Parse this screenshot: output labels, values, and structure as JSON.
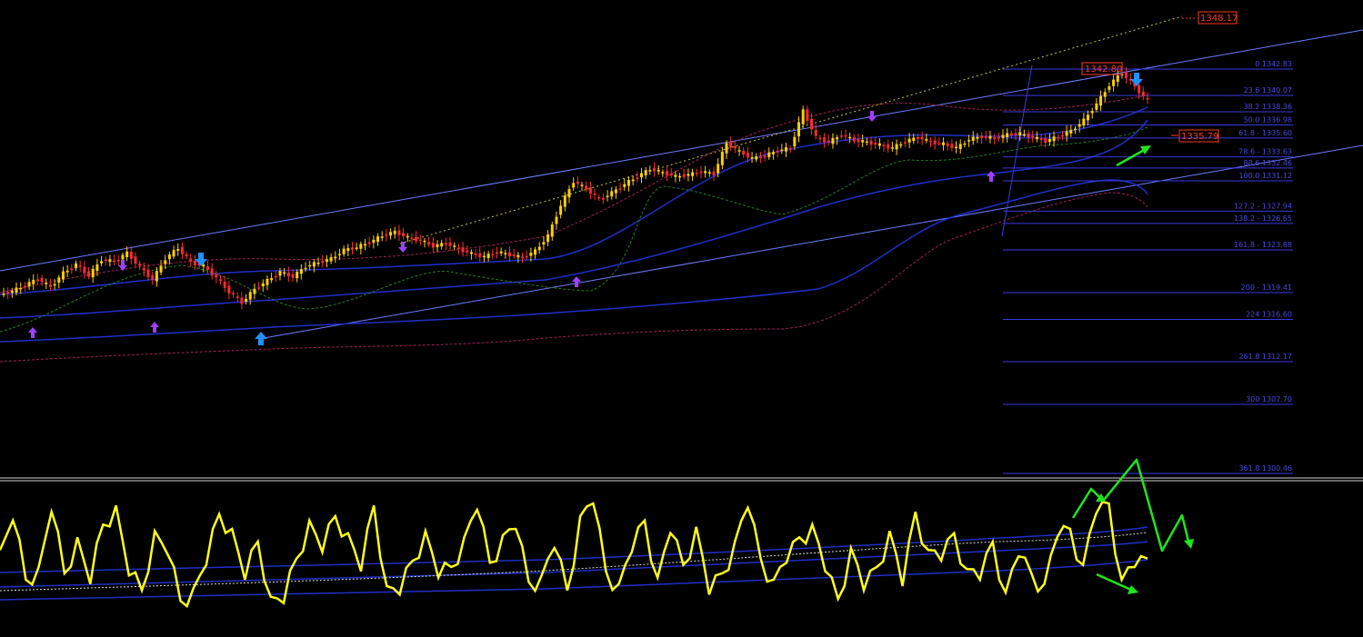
{
  "colors": {
    "background": "#000000",
    "bull_candle": "#ffd000",
    "bear_candle": "#ff2a2a",
    "channel": "#6f7dff",
    "ma_blue": "#1f2fc8",
    "band_magenta": "#a0205a",
    "band_green": "#2c7a2c",
    "fib_line": "#3a3ae0",
    "fib_text": "#4a4ae0",
    "oscillator": "#ffff1a",
    "annotation_arrow": "#1ee61e",
    "price_tag": "#ff3a1a",
    "arrow_signal": "#a040ff",
    "arrow_signal_alt": "#2090ff"
  },
  "price_tags": [
    {
      "value": "1348.17"
    },
    {
      "value": "1342.80"
    },
    {
      "value": "1335.79"
    }
  ],
  "chart_data": [
    {
      "type": "candlestick",
      "fib_levels": [
        {
          "label": "0 1342.83",
          "price": 1342.83
        },
        {
          "label": "23.6 1340.07",
          "price": 1340.07
        },
        {
          "label": "38.2 1338.36",
          "price": 1338.36
        },
        {
          "label": "50.0 1336.98",
          "price": 1336.98
        },
        {
          "label": "61.8 - 1335.60",
          "price": 1335.6
        },
        {
          "label": "78.6 - 1333.63",
          "price": 1333.63
        },
        {
          "label": "88.6 1332.46",
          "price": 1332.46
        },
        {
          "label": "100.0 1331.12",
          "price": 1331.12
        },
        {
          "label": "127.2 - 1327.94",
          "price": 1327.94
        },
        {
          "label": "138.2 - 1326.65",
          "price": 1326.65
        },
        {
          "label": "161.8 - 1323.88",
          "price": 1323.88
        },
        {
          "label": "200 - 1319.41",
          "price": 1319.41
        },
        {
          "label": "224 1316.60",
          "price": 1316.6
        },
        {
          "label": "261.8 1312.17",
          "price": 1312.17
        },
        {
          "label": "300 1307.70",
          "price": 1307.7
        },
        {
          "label": "361.8 1300.46",
          "price": 1300.46
        }
      ],
      "close_series": [
        1319.0,
        1319.6,
        1320.3,
        1319.4,
        1320.9,
        1321.8,
        1320.6,
        1322.3,
        1322.1,
        1323.0,
        1321.5,
        1320.2,
        1322.4,
        1323.5,
        1322.0,
        1321.6,
        1320.4,
        1318.9,
        1317.8,
        1319.2,
        1320.1,
        1321.0,
        1320.5,
        1321.6,
        1322.0,
        1322.4,
        1323.3,
        1323.6,
        1324.1,
        1324.8,
        1325.2,
        1324.6,
        1324.3,
        1323.7,
        1324.0,
        1323.4,
        1322.9,
        1322.6,
        1323.1,
        1322.8,
        1322.5,
        1323.2,
        1324.8,
        1328.0,
        1330.5,
        1329.7,
        1328.6,
        1329.3,
        1330.2,
        1331.0,
        1331.8,
        1331.4,
        1331.0,
        1331.2,
        1331.5,
        1331.3,
        1334.5,
        1333.6,
        1332.9,
        1333.2,
        1333.7,
        1334.0,
        1337.9,
        1335.1,
        1334.6,
        1335.4,
        1334.8,
        1334.6,
        1334.3,
        1334.0,
        1334.7,
        1335.1,
        1334.6,
        1334.4,
        1334.0,
        1334.9,
        1335.2,
        1335.0,
        1335.4,
        1335.5,
        1335.1,
        1334.7,
        1335.2,
        1335.8,
        1336.9,
        1338.6,
        1340.6,
        1341.9,
        1340.4,
        1338.9
      ],
      "oscillator_series": [
        52,
        66,
        38,
        44,
        70,
        41,
        58,
        36,
        64,
        73,
        40,
        33,
        61,
        50,
        28,
        34,
        45,
        69,
        62,
        38,
        56,
        30,
        27,
        48,
        66,
        51,
        68,
        60,
        42,
        73,
        35,
        31,
        47,
        61,
        39,
        44,
        58,
        71,
        46,
        59,
        62,
        37,
        40,
        53,
        33,
        68,
        74,
        42,
        36,
        51,
        66,
        39,
        60,
        45,
        63,
        31,
        41,
        56,
        72,
        48,
        38,
        46,
        58,
        64,
        42,
        29,
        53,
        33,
        44,
        61,
        35,
        70,
        52,
        47,
        60,
        43,
        38,
        56,
        32,
        49,
        41,
        36,
        58,
        62,
        45,
        69,
        74,
        38,
        44,
        48
      ]
    }
  ]
}
